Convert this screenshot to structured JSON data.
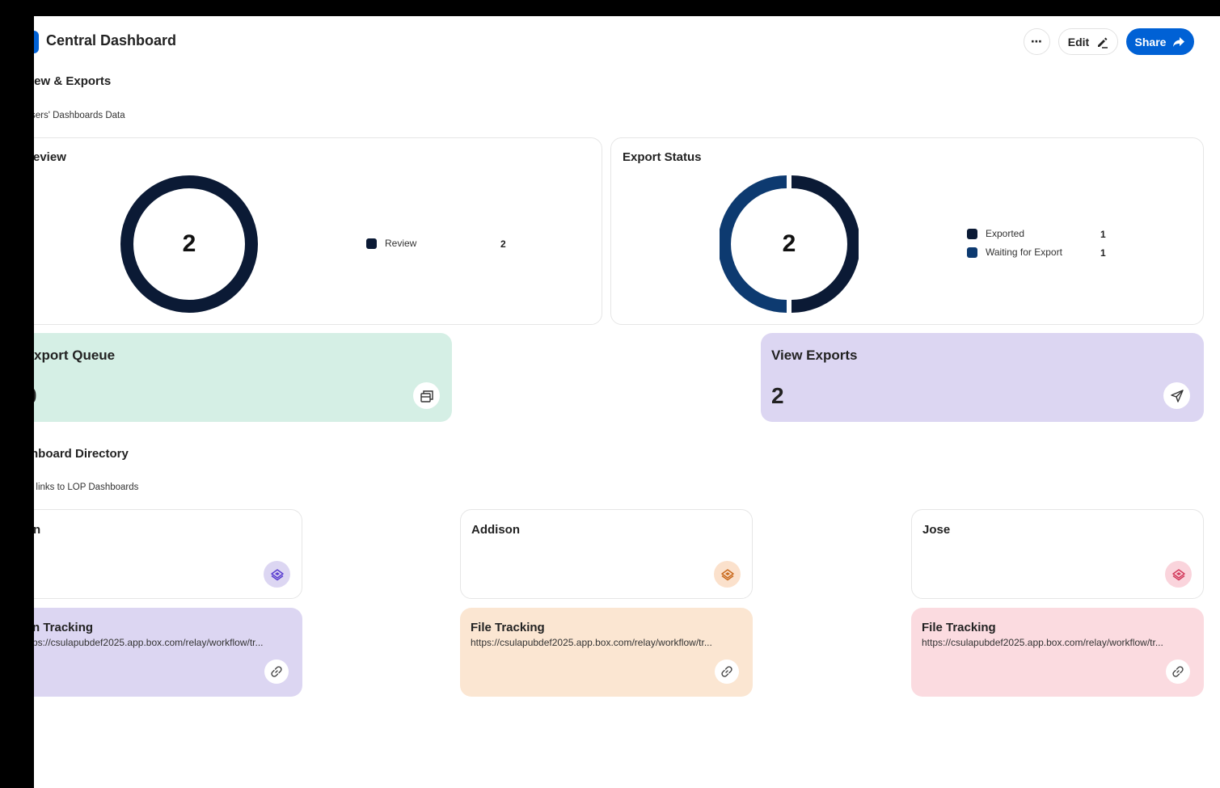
{
  "header": {
    "title": "Central Dashboard",
    "more_label": "⋯",
    "edit_label": "Edit",
    "share_label": "Share"
  },
  "section_review": {
    "title": "iew & Exports",
    "subtitle": "sers' Dashboards Data"
  },
  "review_card": {
    "title": "eview",
    "center_value": "2",
    "legend": [
      {
        "label": "Review",
        "value": "2",
        "color": "#0b1a35"
      }
    ]
  },
  "export_card": {
    "title": "Export Status",
    "center_value": "2",
    "legend": [
      {
        "label": "Exported",
        "value": "1",
        "color": "#0b1a35"
      },
      {
        "label": "Waiting for Export",
        "value": "1",
        "color": "#0d3a70"
      }
    ]
  },
  "metrics": {
    "export_queue": {
      "title": "xport Queue",
      "value": "0",
      "bg": "#d5efe5"
    },
    "view_exports": {
      "title": "View Exports",
      "value": "2",
      "bg": "#dcd6f2"
    }
  },
  "section_directory": {
    "title": "hboard Directory",
    "subtitle": "t links to LOP Dashboards"
  },
  "people": [
    {
      "name": "n",
      "icon_bg": "#dcd6f2",
      "icon_color": "#5a3fd0"
    },
    {
      "name": "Addison",
      "icon_bg": "#fbe1cc",
      "icon_color": "#c96a1e"
    },
    {
      "name": "Jose",
      "icon_bg": "#fad4dc",
      "icon_color": "#d23a5c"
    }
  ],
  "links": [
    {
      "title": "n Tracking",
      "url": "ps://csulapubdef2025.app.box.com/relay/workflow/tr...",
      "bg": "#dcd6f2"
    },
    {
      "title": "File Tracking",
      "url": "https://csulapubdef2025.app.box.com/relay/workflow/tr...",
      "bg": "#fbe6d2"
    },
    {
      "title": "File Tracking",
      "url": "https://csulapubdef2025.app.box.com/relay/workflow/tr...",
      "bg": "#fbdbe0"
    }
  ]
}
